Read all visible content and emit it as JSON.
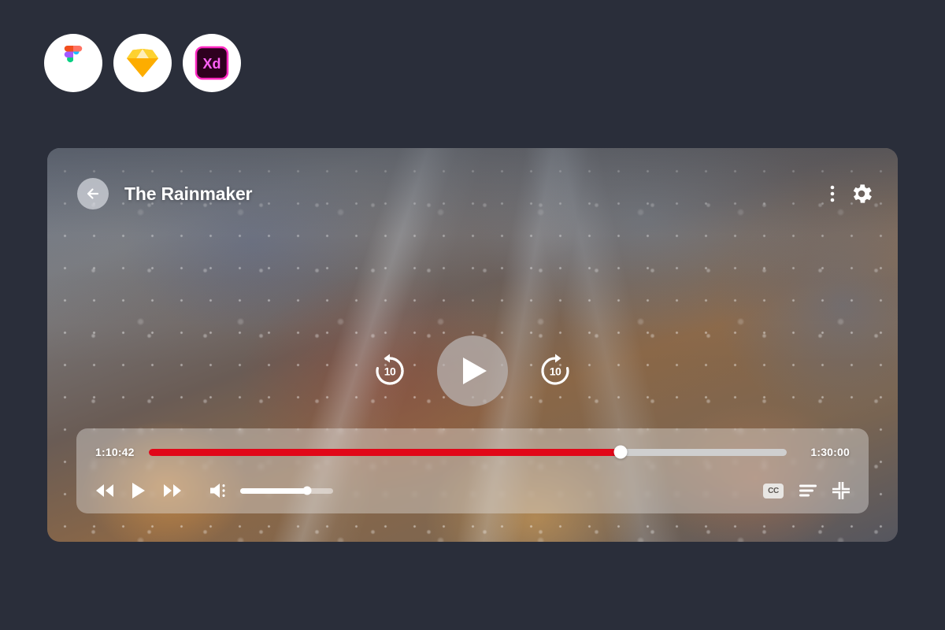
{
  "tool_badges": [
    {
      "name": "figma-badge",
      "label": "Figma"
    },
    {
      "name": "sketch-badge",
      "label": "Sketch"
    },
    {
      "name": "adobe-xd-badge",
      "label": "Xd"
    }
  ],
  "player": {
    "header": {
      "back_icon": "arrow-left-icon",
      "title": "The Rainmaker",
      "more_icon": "more-vertical-icon",
      "settings_icon": "gear-icon"
    },
    "center": {
      "rewind_label": "10",
      "rewind_icon": "rewind-10-icon",
      "play_icon": "play-icon",
      "forward_label": "10",
      "forward_icon": "forward-10-icon"
    },
    "controls": {
      "current_time": "1:10:42",
      "total_time": "1:30:00",
      "progress_percent": 74,
      "volume_percent": 72,
      "previous_icon": "rewind-previous-icon",
      "play_icon": "play-icon",
      "next_icon": "fast-forward-next-icon",
      "volume_icon": "volume-icon",
      "cc_label": "CC",
      "cc_icon": "closed-captions-icon",
      "playlist_icon": "playlist-icon",
      "fullscreen_exit_icon": "fullscreen-exit-icon"
    }
  },
  "colors": {
    "page_background": "#2a2e3a",
    "progress_accent": "#e10718",
    "progress_track": "#cfcfcf",
    "badge_background": "#ffffff"
  }
}
